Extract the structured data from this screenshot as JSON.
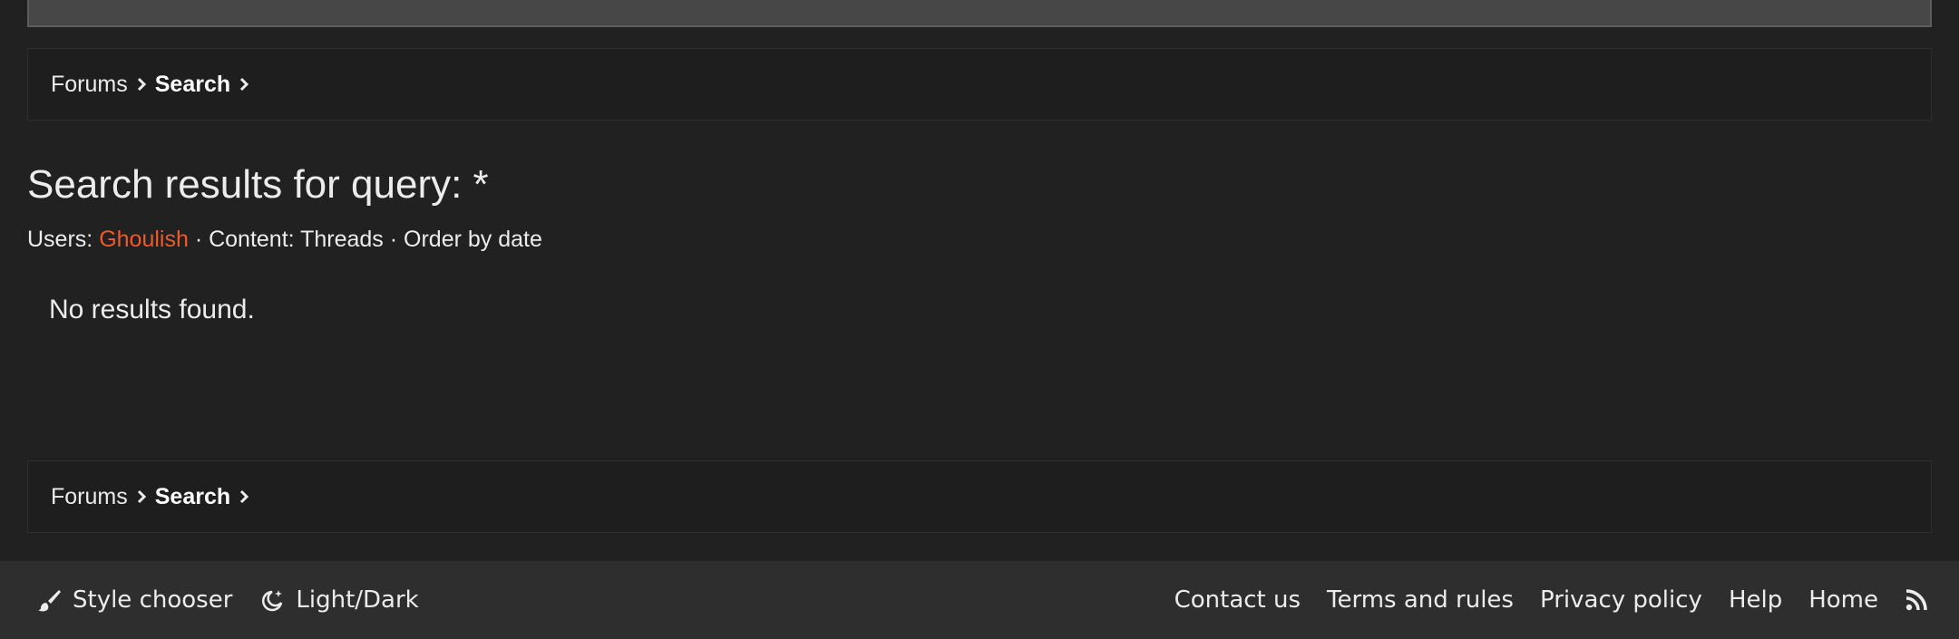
{
  "breadcrumb": {
    "items": [
      "Forums",
      "Search"
    ]
  },
  "search": {
    "title": "Search results for query: *",
    "meta": {
      "users_label": "Users:",
      "user": "Ghoulish",
      "content": "· Content: Threads",
      "order": "· Order by date"
    },
    "empty_message": "No results found."
  },
  "footer": {
    "style_chooser": "Style chooser",
    "light_dark": "Light/Dark",
    "links": [
      "Contact us",
      "Terms and rules",
      "Privacy policy",
      "Help",
      "Home"
    ],
    "rss_icon": "rss-icon"
  },
  "colors": {
    "background": "#212121",
    "accent": "#f05a28",
    "footer_bg": "#2e2e2e"
  }
}
